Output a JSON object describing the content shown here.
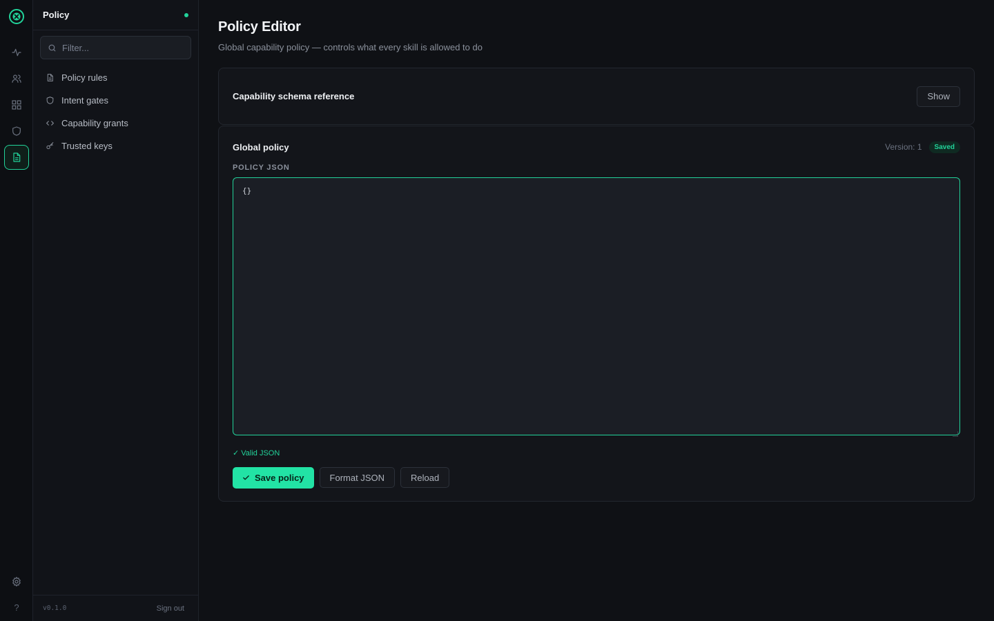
{
  "rail": {
    "logo_icon": "logo-icon",
    "items": [
      {
        "icon": "activity-icon",
        "active": false
      },
      {
        "icon": "users-icon",
        "active": false
      },
      {
        "icon": "grid-icon",
        "active": false
      },
      {
        "icon": "shield-icon",
        "active": false
      },
      {
        "icon": "document-icon",
        "active": true
      }
    ],
    "settings_icon": "gear-icon",
    "help_label": "?"
  },
  "sidebar": {
    "title": "Policy",
    "status_color": "#22d39a",
    "filter_placeholder": "Filter...",
    "items": [
      {
        "label": "Policy rules",
        "icon": "document-icon"
      },
      {
        "label": "Intent gates",
        "icon": "shield-icon"
      },
      {
        "label": "Capability grants",
        "icon": "code-icon"
      },
      {
        "label": "Trusted keys",
        "icon": "key-icon"
      }
    ],
    "version": "v0.1.0",
    "signout_label": "Sign out"
  },
  "main": {
    "title": "Policy Editor",
    "subtitle": "Global capability policy — controls what every skill is allowed to do",
    "schema_card": {
      "title": "Capability schema reference",
      "toggle_label": "Show"
    },
    "policy_card": {
      "title": "Global policy",
      "version_label": "Version: 1",
      "status_badge": "Saved",
      "field_label": "POLICY JSON",
      "editor_value": "{}",
      "validation_text": "✓ Valid JSON",
      "save_label": "Save policy",
      "format_label": "Format JSON",
      "reload_label": "Reload"
    }
  },
  "colors": {
    "accent": "#22d39a",
    "background": "#0f1115"
  }
}
